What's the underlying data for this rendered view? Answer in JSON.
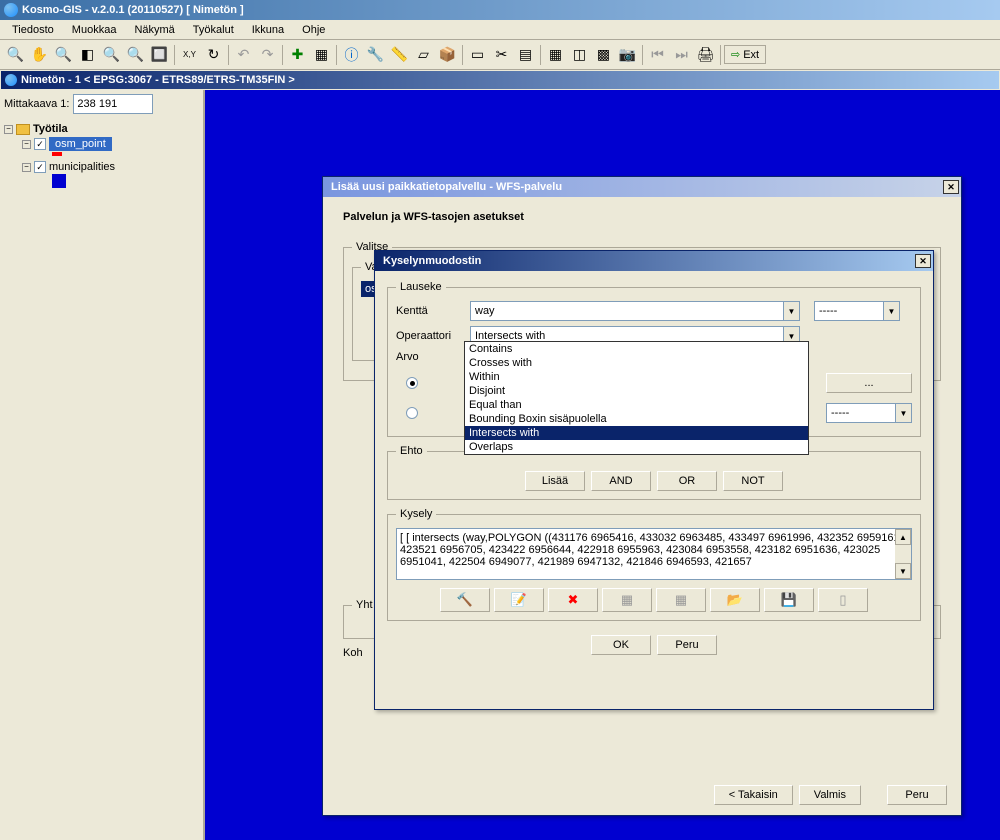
{
  "app": {
    "title": "Kosmo-GIS - v.2.0.1 (20110527)  [ Nimetön ]"
  },
  "menu": [
    "Tiedosto",
    "Muokkaa",
    "Näkymä",
    "Työkalut",
    "Ikkuna",
    "Ohje"
  ],
  "ext_label": "Ext",
  "doc_title": "Nimetön - 1 < EPSG:3067 - ETRS89/ETRS-TM35FIN >",
  "scale": {
    "label": "Mittakaava 1:",
    "value": "238 191"
  },
  "tree": {
    "root": "Työtila",
    "layer1": "osm_point",
    "layer2": "municipalities"
  },
  "dialog1": {
    "title": "Lisää uusi paikkatietopalvellu - WFS-palvelu",
    "heading": "Palvelun ja WFS-tasojen asetukset",
    "fs_valitse": "Valitse",
    "fs_vali": "Vali",
    "item_osm": "osm",
    "fs_yht": "Yht",
    "lbl_koh": "Koh",
    "btn_back": "< Takaisin",
    "btn_finish": "Valmis",
    "btn_cancel": "Peru"
  },
  "dialog2": {
    "title": "Kyselynmuodostin",
    "fs_lauseke": "Lauseke",
    "lbl_kentta": "Kenttä",
    "val_kentta": "way",
    "val_blank": "-----",
    "lbl_operaattori": "Operaattori",
    "val_operaattori": "Intersects with",
    "lbl_arvo": "Arvo",
    "btn_dots": "...",
    "fs_ehto": "Ehto",
    "btn_lisaa": "Lisää",
    "btn_and": "AND",
    "btn_or": "OR",
    "btn_not": "NOT",
    "fs_kysely": "Kysely",
    "query_text": "[  [  intersects (way,POLYGON ((431176 6965416, 433032 6963485, 433497 6961996, 432352 6959161, 423521 6956705, 423422 6956644, 422918 6955963, 423084 6953558, 423182 6951636, 423025 6951041, 422504 6949077, 421989 6947132, 421846 6946593, 421657",
    "btn_ok": "OK",
    "btn_peru": "Peru",
    "dropdown": [
      "Contains",
      "Crosses with",
      "Within",
      "Disjoint",
      "Equal than",
      "Bounding Boxin sisäpuolella",
      "Intersects with",
      "Overlaps"
    ],
    "dropdown_selected": "Intersects with"
  }
}
